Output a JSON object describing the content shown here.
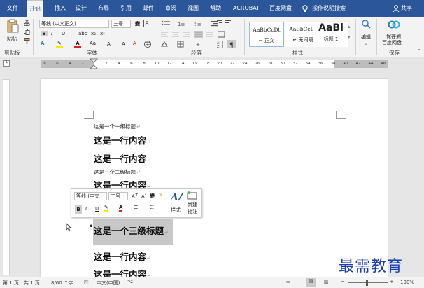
{
  "tabs": [
    "文件",
    "开始",
    "插入",
    "设计",
    "布局",
    "引用",
    "邮件",
    "审阅",
    "视图",
    "帮助",
    "ACROBAT",
    "百度网盘"
  ],
  "tell_me": "操作说明搜索",
  "share": "共享",
  "ribbon": {
    "clipboard": {
      "paste": "粘贴",
      "group": "剪贴板"
    },
    "font": {
      "name": "等线 (中文正文)",
      "size": "三号",
      "group": "字体"
    },
    "paragraph": {
      "group": "段落"
    },
    "styles": {
      "group": "样式",
      "items": [
        {
          "preview": "AaBbCcDt",
          "name": "↵ 正文"
        },
        {
          "preview": "AaBbCcDt",
          "name": "↵ 无间隔"
        },
        {
          "preview": "AaBl",
          "name": "标题 1"
        }
      ]
    },
    "editing": {
      "label": "编辑"
    },
    "save": {
      "label1": "保存到",
      "label2": "百度网盘",
      "group": "保存"
    }
  },
  "ruler": {
    "left_ticks": [
      "8",
      "6",
      "4",
      "2"
    ],
    "ticks": [
      "2",
      "4",
      "6",
      "8",
      "10",
      "12",
      "14",
      "16",
      "18",
      "20",
      "22",
      "24",
      "26",
      "28",
      "30",
      "32",
      "34",
      "36",
      "38",
      "40",
      "42",
      "44",
      "46",
      "48"
    ]
  },
  "document": {
    "lines": [
      {
        "text": "这是一个一级标题",
        "kind": "small"
      },
      {
        "text": "这是一行内容",
        "kind": "big"
      },
      {
        "text": "这是一行内容",
        "kind": "big"
      },
      {
        "text": "这是一个二级标题",
        "kind": "small"
      },
      {
        "text": "这是一行内容",
        "kind": "big"
      },
      {
        "text": "这是一个三级标题",
        "kind": "selected"
      },
      {
        "text": "这是一行内容",
        "kind": "big"
      },
      {
        "text": "这是一行内容",
        "kind": "big"
      }
    ],
    "para_mark": "↵"
  },
  "mini_toolbar": {
    "font": "等线 (中文",
    "size": "三号",
    "styles": "样式",
    "new_comment_1": "新建",
    "new_comment_2": "批注"
  },
  "status": {
    "page": "第 1 页，共 1 页",
    "words": "8/60 个字",
    "language": "中文(中国)",
    "zoom": "100%"
  },
  "watermark": "最需教育"
}
